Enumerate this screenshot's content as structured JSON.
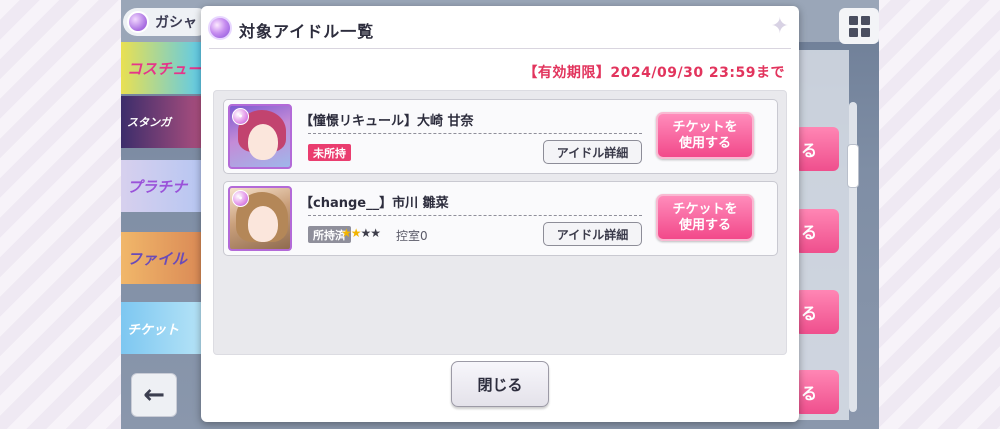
{
  "background": {
    "gacha_tab_label": "ガシャ",
    "banners": [
      "コスチュー",
      "スタンガ",
      "プラチナ",
      "ファイル",
      "チケット"
    ],
    "back_icon": "←",
    "use_button_fragment": "る"
  },
  "dialog": {
    "title": "対象アイドル一覧",
    "expiry": "【有効期限】2024/09/30 23:59まで",
    "cards": [
      {
        "name": "【憧憬リキュール】大崎 甘奈",
        "ownership": "未所持",
        "detail_label": "アイドル詳細",
        "use_label": "チケットを\n使用する"
      },
      {
        "name": "【change__】市川 雛菜",
        "ownership": "所持済",
        "stars_on": "★★",
        "stars_off": "★★",
        "rank_text": "控室0",
        "detail_label": "アイドル詳細",
        "use_label": "チケットを\n使用する"
      }
    ],
    "close_label": "閉じる"
  },
  "colors": {
    "accent_pink": "#f2498a",
    "expiry_red": "#e2345d",
    "unowned_badge": "#ea3d6f",
    "owned_badge": "#8f8f9b",
    "star_gold": "#f2b400"
  },
  "icons": [
    "gacha-orb-icon",
    "grid-menu-icon",
    "back-arrow-icon",
    "sparkle-icon",
    "orb-badge-icon"
  ]
}
